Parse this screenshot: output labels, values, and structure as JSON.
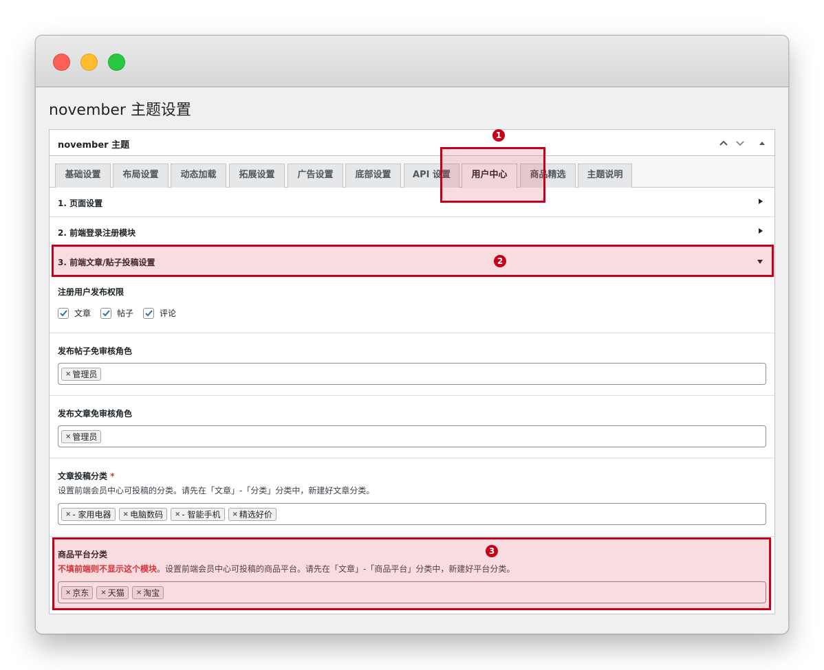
{
  "page": {
    "title": "november 主题设置"
  },
  "postbox": {
    "title": "november 主题",
    "controls": {
      "up_icon": "chevron-up-icon",
      "down_icon": "chevron-down-icon",
      "toggle_icon": "caret-up-icon"
    }
  },
  "tabs": [
    {
      "label": "基础设置"
    },
    {
      "label": "布局设置"
    },
    {
      "label": "动态加载"
    },
    {
      "label": "拓展设置"
    },
    {
      "label": "广告设置"
    },
    {
      "label": "底部设置"
    },
    {
      "label": "API 设置"
    },
    {
      "label": "用户中心",
      "active": true
    },
    {
      "label": "商品精选"
    },
    {
      "label": "主题说明"
    }
  ],
  "sections": [
    {
      "title": "1. 页面设置",
      "expanded": false
    },
    {
      "title": "2. 前端登录注册模块",
      "expanded": false
    },
    {
      "title": "3. 前端文章/贴子投稿设置",
      "expanded": true
    }
  ],
  "fields": {
    "publish_permission": {
      "label": "注册用户发布权限",
      "options": [
        {
          "label": "文章",
          "checked": true
        },
        {
          "label": "帖子",
          "checked": true
        },
        {
          "label": "评论",
          "checked": true
        }
      ]
    },
    "post_exempt_role": {
      "label": "发布帖子免审核角色",
      "tokens": [
        "管理员"
      ]
    },
    "article_exempt_role": {
      "label": "发布文章免审核角色",
      "tokens": [
        "管理员"
      ]
    },
    "article_category": {
      "label": "文章投稿分类",
      "required_mark": "*",
      "description": "设置前端会员中心可投稿的分类。请先在「文章」-「分类」分类中，新建好文章分类。",
      "tokens": [
        "- 家用电器",
        "电脑数码",
        "- 智能手机",
        "精选好价"
      ]
    },
    "product_platform": {
      "label": "商品平台分类",
      "warning": "不填前端则不显示这个模块",
      "description": "。设置前端会员中心可投稿的商品平台。请先在「文章」-「商品平台」分类中，新建好平台分类。",
      "tokens": [
        "京东",
        "天猫",
        "淘宝"
      ]
    }
  },
  "annotations": [
    "1",
    "2",
    "3"
  ],
  "colors": {
    "highlight": "#c4001a",
    "required": "#d63638",
    "checkbox": "#2271b1"
  }
}
